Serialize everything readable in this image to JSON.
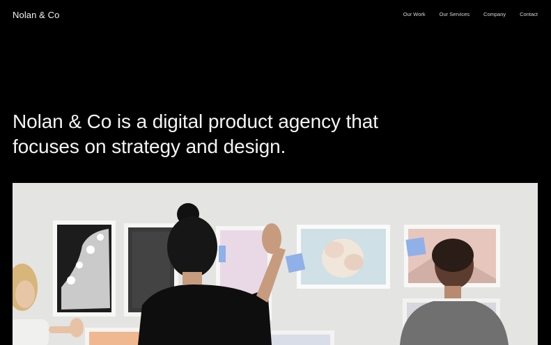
{
  "header": {
    "logo": "Nolan & Co",
    "nav": [
      {
        "label": "Our Work"
      },
      {
        "label": "Our Services"
      },
      {
        "label": "Company"
      },
      {
        "label": "Contact"
      }
    ]
  },
  "hero": {
    "heading": "Nolan & Co is a digital product agency that focuses on strategy and design."
  },
  "colors": {
    "background": "#000000",
    "text": "#ffffff",
    "wall": "#e3e3e1",
    "sticky_note": "#8fb0e8"
  }
}
